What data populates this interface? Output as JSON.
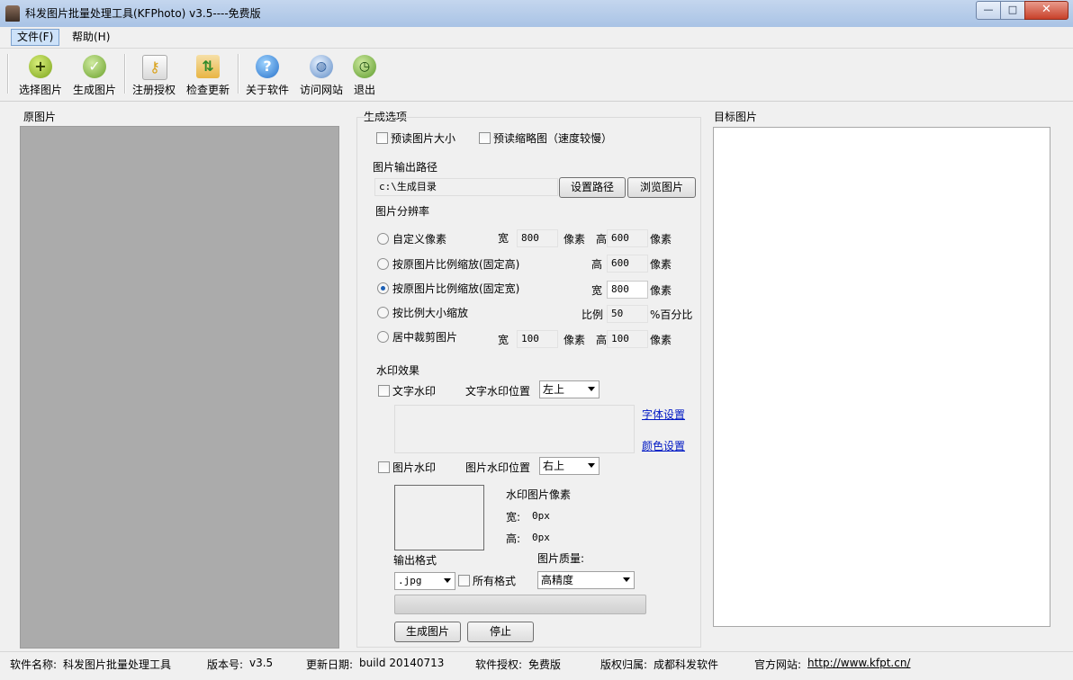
{
  "window": {
    "title": "科发图片批量处理工具(KFPhoto) v3.5----免费版"
  },
  "menu": {
    "file": "文件(F)",
    "help": "帮助(H)"
  },
  "toolbar": {
    "select": "选择图片",
    "generate": "生成图片",
    "register": "注册授权",
    "update": "检查更新",
    "about": "关于软件",
    "visit": "访问网站",
    "exit": "退出"
  },
  "left": {
    "title": "原图片"
  },
  "right": {
    "title": "目标图片"
  },
  "options": {
    "title": "生成选项",
    "preview_size": "预读图片大小",
    "preview_thumb": "预读缩略图（速度较慢）",
    "output_path_label": "图片输出路径",
    "output_path_value": "c:\\生成目录",
    "set_path": "设置路径",
    "browse": "浏览图片",
    "resolution_label": "图片分辨率",
    "width_label": "宽",
    "height_label": "高",
    "pixel_unit": "像素",
    "ratio_label": "比例",
    "percent_unit": "%百分比",
    "modes": {
      "custom": "自定义像素",
      "fixed_height": "按原图片比例缩放(固定高)",
      "fixed_width": "按原图片比例缩放(固定宽)",
      "scale": "按比例大小缩放",
      "crop": "居中裁剪图片"
    },
    "values": {
      "custom_w": "800",
      "custom_h": "600",
      "fixed_h": "600",
      "fixed_w": "800",
      "ratio": "50",
      "crop_w": "100",
      "crop_h": "100"
    },
    "watermark_label": "水印效果",
    "text_watermark": "文字水印",
    "text_pos_label": "文字水印位置",
    "text_pos_value": "左上",
    "font_settings": "字体设置",
    "color_settings": "颜色设置",
    "image_watermark": "图片水印",
    "image_pos_label": "图片水印位置",
    "image_pos_value": "右上",
    "wm_pixels_label": "水印图片像素",
    "wm_w_label": "宽:",
    "wm_w_value": "0px",
    "wm_h_label": "高:",
    "wm_h_value": "0px",
    "format_label": "输出格式",
    "format_value": ".jpg",
    "all_formats": "所有格式",
    "quality_label": "图片质量:",
    "quality_value": "高精度",
    "generate_btn": "生成图片",
    "stop_btn": "停止"
  },
  "status": {
    "name_label": "软件名称:",
    "name_value": "科发图片批量处理工具",
    "version_label": "版本号:",
    "version_value": "v3.5",
    "date_label": "更新日期:",
    "date_value": "build 20140713",
    "license_label": "软件授权:",
    "license_value": "免费版",
    "owner_label": "版权归属:",
    "owner_value": "成都科发软件",
    "site_label": "官方网站:",
    "site_value": "http://www.kfpt.cn/"
  },
  "colors": {
    "source_bg": "#ababab",
    "link": "#0018c4",
    "radio_dot": "#1b5fb5"
  },
  "icons": [
    "plus-icon",
    "check-icon",
    "key-icon",
    "update-icon",
    "help-icon",
    "globe-icon",
    "exit-icon"
  ]
}
